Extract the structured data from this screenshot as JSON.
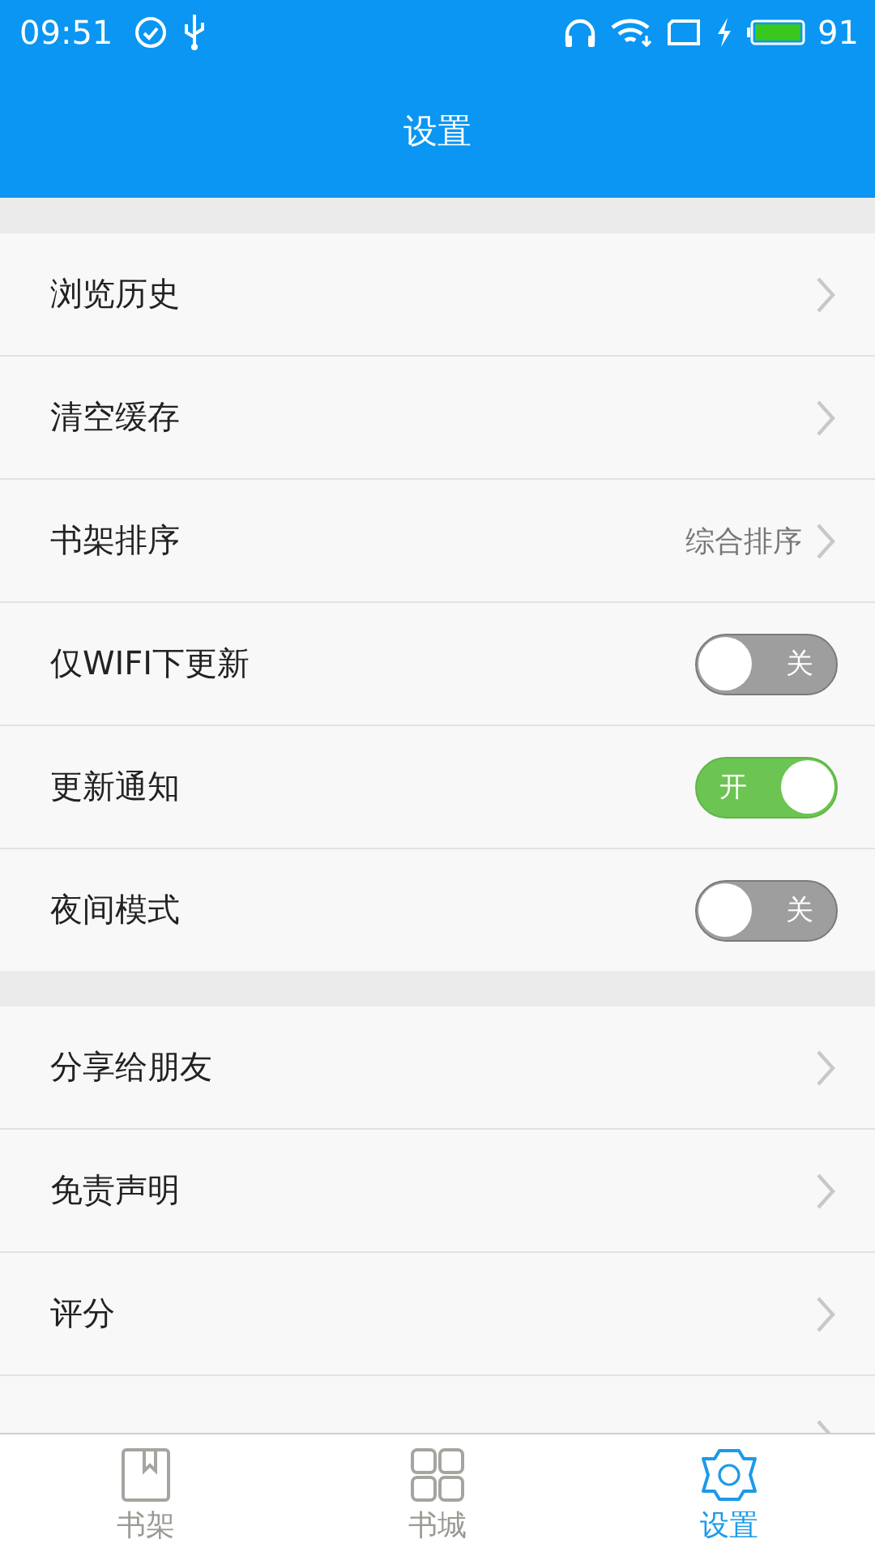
{
  "status_bar": {
    "time": "09:51",
    "battery": "91"
  },
  "header": {
    "title": "设置"
  },
  "sections": [
    {
      "rows": [
        {
          "kind": "link",
          "label": "浏览历史"
        },
        {
          "kind": "link",
          "label": "清空缓存"
        },
        {
          "kind": "link",
          "label": "书架排序",
          "value": "综合排序"
        },
        {
          "kind": "toggle",
          "label": "仅WIFI下更新",
          "on": false,
          "text": "关"
        },
        {
          "kind": "toggle",
          "label": "更新通知",
          "on": true,
          "text": "开"
        },
        {
          "kind": "toggle",
          "label": "夜间模式",
          "on": false,
          "text": "关"
        }
      ]
    },
    {
      "rows": [
        {
          "kind": "link",
          "label": "分享给朋友"
        },
        {
          "kind": "link",
          "label": "免责声明"
        },
        {
          "kind": "link",
          "label": "评分"
        },
        {
          "kind": "link"
        }
      ]
    }
  ],
  "tab_bar": [
    {
      "kind": "shelf",
      "label": "书架",
      "selected": false
    },
    {
      "kind": "store",
      "label": "书城",
      "selected": false
    },
    {
      "kind": "settings",
      "label": "设置",
      "selected": true
    }
  ]
}
